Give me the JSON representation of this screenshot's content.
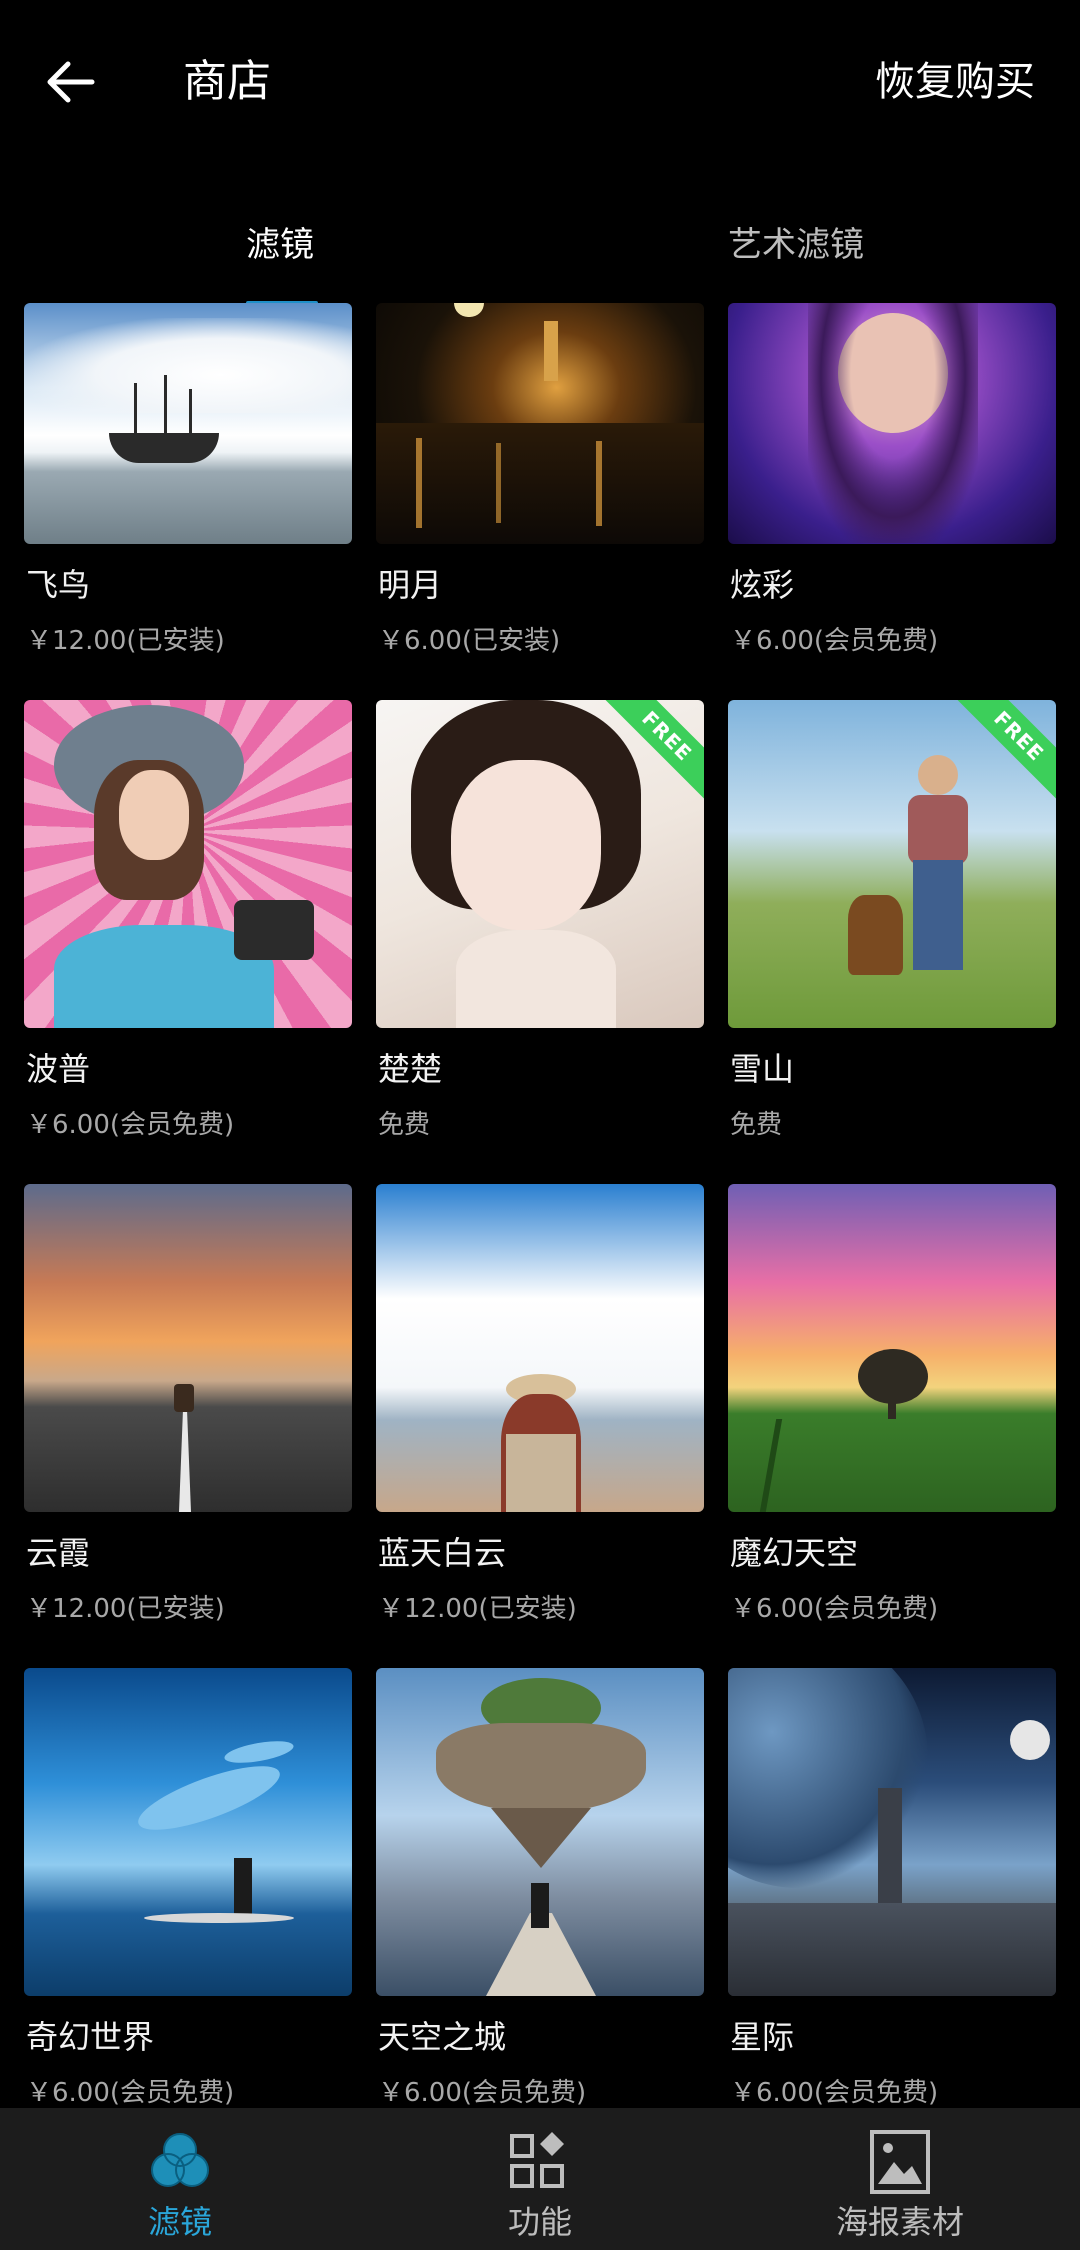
{
  "header": {
    "title": "商店",
    "restore_label": "恢复购买"
  },
  "tabs": [
    {
      "label": "滤镜",
      "active": true
    },
    {
      "label": "艺术滤镜",
      "active": false
    }
  ],
  "filters": [
    {
      "name": "飞鸟",
      "price": "￥12.00(已安装)",
      "image": "sailing-ship-sea",
      "badge": ""
    },
    {
      "name": "明月",
      "price": "￥6.00(已安装)",
      "image": "night-canal-town",
      "badge": ""
    },
    {
      "name": "炫彩",
      "price": "￥6.00(会员免费)",
      "image": "purple-portrait",
      "badge": ""
    },
    {
      "name": "波普",
      "price": "￥6.00(会员免费)",
      "image": "pop-camera-girl",
      "badge": ""
    },
    {
      "name": "楚楚",
      "price": "免费",
      "image": "soft-portrait",
      "badge": "FREE"
    },
    {
      "name": "雪山",
      "price": "免费",
      "image": "meadow-dog",
      "badge": "FREE"
    },
    {
      "name": "云霞",
      "price": "￥12.00(已安装)",
      "image": "sunset-road",
      "badge": ""
    },
    {
      "name": "蓝天白云",
      "price": "￥12.00(已安装)",
      "image": "blue-sky-clouds",
      "badge": ""
    },
    {
      "name": "魔幻天空",
      "price": "￥6.00(会员免费)",
      "image": "magic-sky-tree",
      "badge": ""
    },
    {
      "name": "奇幻世界",
      "price": "￥6.00(会员免费)",
      "image": "fantasy-whales",
      "badge": ""
    },
    {
      "name": "天空之城",
      "price": "￥6.00(会员免费)",
      "image": "floating-castle",
      "badge": ""
    },
    {
      "name": "星际",
      "price": "￥6.00(会员免费)",
      "image": "planet-city",
      "badge": ""
    }
  ],
  "bottom_nav": [
    {
      "label": "滤镜",
      "icon": "filter-circles-icon",
      "active": true
    },
    {
      "label": "功能",
      "icon": "function-grid-icon",
      "active": false
    },
    {
      "label": "海报素材",
      "icon": "poster-image-icon",
      "active": false
    }
  ],
  "colors": {
    "accent": "#2aa6d9",
    "free_badge": "#3ccf5a",
    "background": "#000000",
    "nav_background": "#1c1c1c"
  }
}
